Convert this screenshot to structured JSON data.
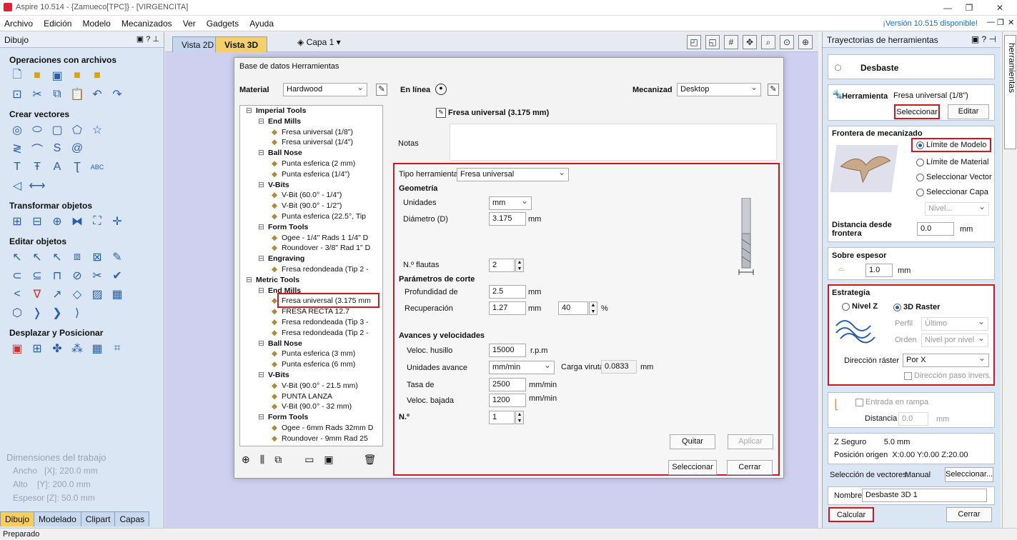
{
  "titlebar": {
    "title": "Aspire 10.514 - {Zamueco[TPC]} - [VIRGENCITA]",
    "min": "—",
    "restore": "❐",
    "close": "✕"
  },
  "menu": {
    "items": [
      "Archivo",
      "Edición",
      "Modelo",
      "Mecanizados",
      "Ver",
      "Gadgets",
      "Ayuda"
    ],
    "update": "¡Versión 10.515 disponible!"
  },
  "left": {
    "title": "Dibujo",
    "sections": [
      "Operaciones con archivos",
      "Crear vectores",
      "Transformar objetos",
      "Editar objetos",
      "Desplazar y Posicionar"
    ],
    "dims_title": "Dimensiones del trabajo",
    "dims_w": "Ancho   [X]: 220.0 mm",
    "dims_h": "Alto    [Y]: 200.0 mm",
    "dims_d": "Espesor [Z]: 50.0 mm",
    "tabs": [
      "Dibujo",
      "Modelado",
      "Clipart",
      "Capas"
    ]
  },
  "view": {
    "tab2d": "Vista 2D",
    "tab3d": "Vista 3D",
    "layer": "Capa 1 ▾"
  },
  "status": "Preparado",
  "dialog": {
    "title": "Base de datos Herramientas",
    "material_label": "Material",
    "material": "Hardwood",
    "online": "En línea",
    "machine_label": "Mecanizad",
    "machine": "Desktop",
    "tool_name": "Fresa universal (3.175 mm)",
    "notes_label": "Notas",
    "tree": [
      {
        "t": "Imperial Tools",
        "lvl": 0,
        "g": true
      },
      {
        "t": "End Mills",
        "lvl": 1,
        "g": true
      },
      {
        "t": "Fresa universal (1/8\")",
        "lvl": 2
      },
      {
        "t": "Fresa universal (1/4\")",
        "lvl": 2
      },
      {
        "t": "Ball Nose",
        "lvl": 1,
        "g": true
      },
      {
        "t": "Punta esferica (2 mm)",
        "lvl": 2
      },
      {
        "t": "Punta esferica (1/4\")",
        "lvl": 2
      },
      {
        "t": "V-Bits",
        "lvl": 1,
        "g": true
      },
      {
        "t": "V-Bit (60.0° - 1/4\")",
        "lvl": 2
      },
      {
        "t": "V-Bit (90.0° - 1/2\")",
        "lvl": 2
      },
      {
        "t": "Punta esferica (22.5°, Tip",
        "lvl": 2
      },
      {
        "t": "Form Tools",
        "lvl": 1,
        "g": true
      },
      {
        "t": "Ogee - 1/4\" Rads 1 1/4\" D",
        "lvl": 2
      },
      {
        "t": "Roundover - 3/8\" Rad 1\" D",
        "lvl": 2
      },
      {
        "t": "Engraving",
        "lvl": 1,
        "g": true
      },
      {
        "t": "Fresa redondeada (Tip 2 -",
        "lvl": 2
      },
      {
        "t": "Metric Tools",
        "lvl": 0,
        "g": true
      },
      {
        "t": "End Mills",
        "lvl": 1,
        "g": true
      },
      {
        "t": "Fresa universal (3.175 mm",
        "lvl": 2
      },
      {
        "t": "FRESA RECTA 12.7",
        "lvl": 2
      },
      {
        "t": "Fresa redondeada (Tip 3 -",
        "lvl": 2
      },
      {
        "t": "Fresa redondeada (Tip 2 -",
        "lvl": 2
      },
      {
        "t": "Ball Nose",
        "lvl": 1,
        "g": true
      },
      {
        "t": "Punta esferica (3 mm)",
        "lvl": 2
      },
      {
        "t": "Punta esferica (6 mm)",
        "lvl": 2
      },
      {
        "t": "V-Bits",
        "lvl": 1,
        "g": true
      },
      {
        "t": "V-Bit (90.0° - 21.5 mm)",
        "lvl": 2
      },
      {
        "t": "PUNTA LANZA",
        "lvl": 2
      },
      {
        "t": "V-Bit (90.0° - 32 mm)",
        "lvl": 2
      },
      {
        "t": "Form Tools",
        "lvl": 1,
        "g": true
      },
      {
        "t": "Ogee - 6mm Rads 32mm D",
        "lvl": 2
      },
      {
        "t": "Roundover - 9mm Rad 25",
        "lvl": 2
      }
    ],
    "tipo_label": "Tipo herramienta",
    "tipo": "Fresa universal",
    "geometria": "Geometría",
    "unidades_label": "Unidades",
    "unidades": "mm",
    "diametro_label": "Diámetro (D)",
    "diametro": "3.175",
    "mm": "mm",
    "flautas_label": "N.º flautas",
    "flautas": "2",
    "corte": "Parámetros de corte",
    "prof_label": "Profundidad de",
    "prof": "2.5",
    "recup_label": "Recuperación",
    "recup": "1.27",
    "recup_pct": "40",
    "pct": "%",
    "avances": "Avances y velocidades",
    "husillo_label": "Veloc. husillo",
    "husillo": "15000",
    "rpm": "r.p.m",
    "uavance_label": "Unidades avance",
    "uavance": "mm/min",
    "viruta_label": "Carga viruta",
    "viruta": "0.0833",
    "tasa_label": "Tasa de",
    "tasa": "2500",
    "bajada_label": "Veloc. bajada",
    "bajada": "1200",
    "mmmin": "mm/min",
    "n_label": "N.º",
    "n": "1",
    "quitar": "Quitar",
    "aplicar": "Aplicar",
    "seleccionar": "Seleccionar",
    "cerrar": "Cerrar"
  },
  "right": {
    "title": "Trayectorias de herramientas",
    "op": "Desbaste",
    "herr_label": "Herramienta",
    "herr": "Fresa universal (1/8\")",
    "seleccionar": "Seleccionar",
    "editar": "Editar",
    "frontera": "Frontera de mecanizado",
    "r1": "Límite de Modelo",
    "r2": "Límite de Material",
    "r3": "Seleccionar Vector",
    "r4": "Seleccionar Capa",
    "nivel": "Nivel...",
    "dist_label": "Distancia desde frontera",
    "dist": "0.0",
    "mm": "mm",
    "sobre": "Sobre espesor",
    "sobre_v": "1.0",
    "estrategia": "Estrategia",
    "nivelz": "Nivel Z",
    "raster": "3D Raster",
    "perfil_label": "Perfil",
    "perfil": "Último",
    "orden_label": "Orden",
    "orden": "Nivel por nivel",
    "dir_label": "Dirección ráster",
    "dir": "Por X",
    "inv": "Dirección paso invers.",
    "rampa": "Entrada en rampa",
    "dist2_label": "Distancia",
    "dist2": "0.0",
    "zseguro": "Z Seguro        5.0 mm",
    "origen": "Posición origen  X:0.00 Y:0.00 Z:20.00",
    "selvec_label": "Selección de vectores:",
    "selvec": "Manual",
    "selvec_btn": "Seleccionar...",
    "nombre_label": "Nombre",
    "nombre": "Desbaste 3D 1",
    "calcular": "Calcular",
    "cerrar": "Cerrar",
    "vtab": "Trayectorias de herramientas"
  }
}
